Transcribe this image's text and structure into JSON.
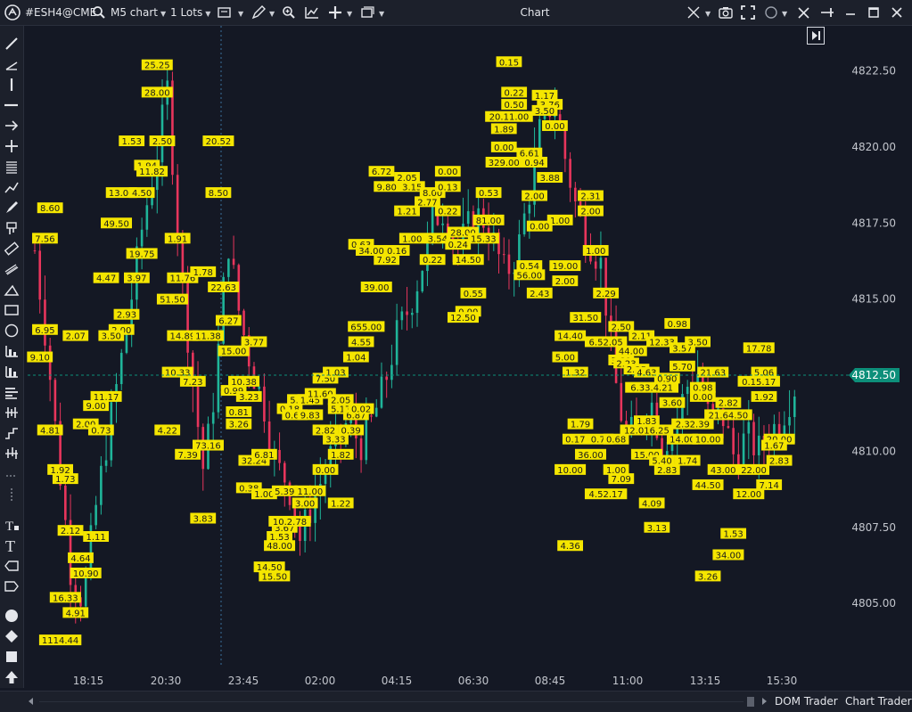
{
  "topbar": {
    "symbol": "#ESH4@CME",
    "timeframe": "M5 chart",
    "lots": "1 Lots",
    "title": "Chart"
  },
  "bottombar": {
    "dom_trader": "DOM Trader",
    "chart_trader": "Chart Trader"
  },
  "colors": {
    "background": "#141824",
    "up": "#1fb59a",
    "down": "#e8355c",
    "label_bg": "#f5e600",
    "current_price": "#0d8f7a"
  },
  "chart_data": {
    "type": "candlestick",
    "symbol": "#ESH4@CME",
    "timeframe": "M5",
    "y_ticks": [
      "4822.50",
      "4820.00",
      "4817.50",
      "4815.00",
      "4812.50",
      "4810.00",
      "4807.50",
      "4805.00"
    ],
    "ylim": [
      4803.0,
      4823.5
    ],
    "x_ticks": [
      "18:15",
      "20:30",
      "23:45",
      "02:00",
      "04:15",
      "06:30",
      "08:45",
      "11:00",
      "13:15",
      "15:30"
    ],
    "current_price": "4812.50",
    "closes": [
      4816.6,
      4813.5,
      4809.6,
      4806.0,
      4805.1,
      4808.0,
      4810.4,
      4812.6,
      4815.0,
      4817.6,
      4819.4,
      4821.9,
      4816.5,
      4812.6,
      4809.3,
      4812.3,
      4817.0,
      4814.4,
      4812.7,
      4811.5,
      4809.5,
      4809.0,
      4807.1,
      4808.3,
      4809.3,
      4810.3,
      4811.0,
      4810.2,
      4811.0,
      4812.2,
      4813.8,
      4814.7,
      4815.9,
      4817.6,
      4818.0,
      4816.6,
      4817.4,
      4817.8,
      4816.9,
      4815.8,
      4816.5,
      4818.5,
      4820.8,
      4821.5,
      4819.6,
      4817.8,
      4816.9,
      4816.1,
      4812.6,
      4810.4,
      4810.8,
      4811.8,
      4810.3,
      4810.7,
      4812.1,
      4812.6,
      4810.9,
      4811.2,
      4809.8,
      4810.5,
      4810.0,
      4810.6,
      4811.2,
      4812.1
    ],
    "labels": [
      {
        "text": "25.25",
        "x": 24,
        "y": 4822.7
      },
      {
        "text": "28.00",
        "x": 24,
        "y": 4821.8
      },
      {
        "text": "1.53",
        "x": 19,
        "y": 4820.2
      },
      {
        "text": "2.50",
        "x": 25,
        "y": 4820.2
      },
      {
        "text": "20.52",
        "x": 36,
        "y": 4820.2
      },
      {
        "text": "1.94",
        "x": 22,
        "y": 4819.4
      },
      {
        "text": "11.82",
        "x": 23,
        "y": 4819.2
      },
      {
        "text": "13.00",
        "x": 17,
        "y": 4818.5
      },
      {
        "text": "4.50",
        "x": 21,
        "y": 4818.5
      },
      {
        "text": "8.50",
        "x": 36,
        "y": 4818.5
      },
      {
        "text": "8.60",
        "x": 3,
        "y": 4818.0
      },
      {
        "text": "49.50",
        "x": 16,
        "y": 4817.5
      },
      {
        "text": "7.56",
        "x": 2,
        "y": 4817.0
      },
      {
        "text": "1.91",
        "x": 28,
        "y": 4817.0
      },
      {
        "text": "19.75",
        "x": 21,
        "y": 4816.5
      },
      {
        "text": "4.47",
        "x": 14,
        "y": 4815.7
      },
      {
        "text": "3.97",
        "x": 20,
        "y": 4815.7
      },
      {
        "text": "11.76",
        "x": 29,
        "y": 4815.7
      },
      {
        "text": "1.78",
        "x": 33,
        "y": 4815.9
      },
      {
        "text": "22.63",
        "x": 37,
        "y": 4815.4
      },
      {
        "text": "51.50",
        "x": 27,
        "y": 4815.0
      },
      {
        "text": "2.93",
        "x": 18,
        "y": 4814.5
      },
      {
        "text": "6.27",
        "x": 38,
        "y": 4814.3
      },
      {
        "text": "6.95",
        "x": 2,
        "y": 4814.0
      },
      {
        "text": "2.00",
        "x": 17,
        "y": 4814.0
      },
      {
        "text": "3.50",
        "x": 15,
        "y": 4813.8
      },
      {
        "text": "2.07",
        "x": 8,
        "y": 4813.8
      },
      {
        "text": "14.89",
        "x": 29,
        "y": 4813.8
      },
      {
        "text": "11.38",
        "x": 34,
        "y": 4813.8
      },
      {
        "text": "3.77",
        "x": 43,
        "y": 4813.6
      },
      {
        "text": "15.00",
        "x": 39,
        "y": 4813.3
      },
      {
        "text": "9.10",
        "x": 1,
        "y": 4813.1
      },
      {
        "text": "10.33",
        "x": 28,
        "y": 4812.6
      },
      {
        "text": "7.23",
        "x": 31,
        "y": 4812.3
      },
      {
        "text": "10.38",
        "x": 41,
        "y": 4812.3
      },
      {
        "text": "0.99",
        "x": 39,
        "y": 4812.0
      },
      {
        "text": "3.23",
        "x": 42,
        "y": 4811.8
      },
      {
        "text": "11.17",
        "x": 14,
        "y": 4811.8
      },
      {
        "text": "9.00",
        "x": 12,
        "y": 4811.5
      },
      {
        "text": "0.81",
        "x": 40,
        "y": 4811.3
      },
      {
        "text": "3.26",
        "x": 40,
        "y": 4810.9
      },
      {
        "text": "2.00",
        "x": 10,
        "y": 4810.9
      },
      {
        "text": "4.81",
        "x": 3,
        "y": 4810.7
      },
      {
        "text": "0.73",
        "x": 13,
        "y": 4810.7
      },
      {
        "text": "4.22",
        "x": 26,
        "y": 4810.7
      },
      {
        "text": "73.16",
        "x": 34,
        "y": 4810.2
      },
      {
        "text": "7.39",
        "x": 30,
        "y": 4809.9
      },
      {
        "text": "32.24",
        "x": 43,
        "y": 4809.7
      },
      {
        "text": "6.81",
        "x": 45,
        "y": 4809.9
      },
      {
        "text": "1.92",
        "x": 5,
        "y": 4809.4
      },
      {
        "text": "1.73",
        "x": 6,
        "y": 4809.1
      },
      {
        "text": "0.38",
        "x": 42,
        "y": 4808.8
      },
      {
        "text": "1.00",
        "x": 45,
        "y": 4808.6
      },
      {
        "text": "3.83",
        "x": 33,
        "y": 4807.8
      },
      {
        "text": "2.12",
        "x": 7,
        "y": 4807.4
      },
      {
        "text": "1.11",
        "x": 12,
        "y": 4807.2
      },
      {
        "text": "4.64",
        "x": 9,
        "y": 4806.5
      },
      {
        "text": "10.90",
        "x": 10,
        "y": 4806.0
      },
      {
        "text": "16.33",
        "x": 6,
        "y": 4805.2
      },
      {
        "text": "4.91",
        "x": 8,
        "y": 4804.7
      },
      {
        "text": "1114.44",
        "x": 5,
        "y": 4803.8
      },
      {
        "text": "14.50",
        "x": 46,
        "y": 4806.2
      },
      {
        "text": "15.50",
        "x": 47,
        "y": 4805.9
      },
      {
        "text": "48.00",
        "x": 48,
        "y": 4806.9
      },
      {
        "text": "1.53",
        "x": 48,
        "y": 4807.2
      },
      {
        "text": "3.67",
        "x": 49,
        "y": 4807.5
      },
      {
        "text": "10.2.78",
        "x": 50,
        "y": 4807.7
      },
      {
        "text": "5.39",
        "x": 49,
        "y": 4808.7
      },
      {
        "text": "3.00",
        "x": 53,
        "y": 4808.3
      },
      {
        "text": "11.00",
        "x": 54,
        "y": 4808.7
      },
      {
        "text": "0.00",
        "x": 57,
        "y": 4809.4
      },
      {
        "text": "0.18",
        "x": 50,
        "y": 4811.4
      },
      {
        "text": "0.62",
        "x": 51,
        "y": 4811.2
      },
      {
        "text": "9.83",
        "x": 54,
        "y": 4811.2
      },
      {
        "text": "5.38",
        "x": 52,
        "y": 4811.7
      },
      {
        "text": "1.45",
        "x": 54,
        "y": 4811.7
      },
      {
        "text": "11.60",
        "x": 56,
        "y": 4811.9
      },
      {
        "text": "7.50",
        "x": 57,
        "y": 4812.4
      },
      {
        "text": "1.03",
        "x": 59,
        "y": 4812.6
      },
      {
        "text": "2.82",
        "x": 57,
        "y": 4810.7
      },
      {
        "text": "3.33",
        "x": 59,
        "y": 4810.4
      },
      {
        "text": "1.82",
        "x": 60,
        "y": 4809.9
      },
      {
        "text": "1.22",
        "x": 60,
        "y": 4808.3
      },
      {
        "text": "2.05",
        "x": 60,
        "y": 4811.7
      },
      {
        "text": "5.17",
        "x": 60,
        "y": 4811.4
      },
      {
        "text": "0.39",
        "x": 62,
        "y": 4810.7
      },
      {
        "text": "6.87",
        "x": 63,
        "y": 4811.2
      },
      {
        "text": "0.02",
        "x": 64,
        "y": 4811.4
      },
      {
        "text": "1.04",
        "x": 63,
        "y": 4813.1
      },
      {
        "text": "4.55",
        "x": 64,
        "y": 4813.6
      },
      {
        "text": "655.00",
        "x": 65,
        "y": 4814.1
      },
      {
        "text": "39.00",
        "x": 67,
        "y": 4815.4
      },
      {
        "text": "0.63",
        "x": 64,
        "y": 4816.8
      },
      {
        "text": "34.00",
        "x": 66,
        "y": 4816.6
      },
      {
        "text": "7.92",
        "x": 69,
        "y": 4816.3
      },
      {
        "text": "0.16",
        "x": 71,
        "y": 4816.6
      },
      {
        "text": "1.00",
        "x": 74,
        "y": 4817.0
      },
      {
        "text": "1.21",
        "x": 73,
        "y": 4817.9
      },
      {
        "text": "0.22",
        "x": 78,
        "y": 4816.3
      },
      {
        "text": "6.72",
        "x": 68,
        "y": 4819.2
      },
      {
        "text": "9.80",
        "x": 69,
        "y": 4818.7
      },
      {
        "text": "2.05",
        "x": 73,
        "y": 4819.0
      },
      {
        "text": "3.15",
        "x": 74,
        "y": 4818.7
      },
      {
        "text": "2.77",
        "x": 77,
        "y": 4818.2
      },
      {
        "text": "8.00",
        "x": 78,
        "y": 4818.5
      },
      {
        "text": "0.00",
        "x": 81,
        "y": 4819.2
      },
      {
        "text": "0.13",
        "x": 81,
        "y": 4818.7
      },
      {
        "text": "0.22",
        "x": 81,
        "y": 4817.9
      },
      {
        "text": "3.54",
        "x": 79,
        "y": 4817.0
      },
      {
        "text": "28.00",
        "x": 84,
        "y": 4817.2
      },
      {
        "text": "0.24",
        "x": 83,
        "y": 4816.8
      },
      {
        "text": "14.50",
        "x": 85,
        "y": 4816.3
      },
      {
        "text": "15.33",
        "x": 88,
        "y": 4817.0
      },
      {
        "text": "0.55",
        "x": 86,
        "y": 4815.2
      },
      {
        "text": "0.00",
        "x": 85,
        "y": 4814.6
      },
      {
        "text": "12.50",
        "x": 84,
        "y": 4814.4
      },
      {
        "text": "81.00",
        "x": 89,
        "y": 4817.6
      },
      {
        "text": "0.53",
        "x": 89,
        "y": 4818.5
      },
      {
        "text": "0.15",
        "x": 93,
        "y": 4822.8
      },
      {
        "text": "0.22",
        "x": 94,
        "y": 4821.8
      },
      {
        "text": "0.50",
        "x": 94,
        "y": 4821.4
      },
      {
        "text": "20.11.00",
        "x": 93,
        "y": 4821.0
      },
      {
        "text": "1.89",
        "x": 92,
        "y": 4820.6
      },
      {
        "text": "0.00",
        "x": 92,
        "y": 4820.0
      },
      {
        "text": "329.00",
        "x": 92,
        "y": 4819.5
      },
      {
        "text": "1.17",
        "x": 100,
        "y": 4821.7
      },
      {
        "text": "3.76",
        "x": 101,
        "y": 4821.4
      },
      {
        "text": "3.50",
        "x": 100,
        "y": 4821.2
      },
      {
        "text": "0.00",
        "x": 102,
        "y": 4820.7
      },
      {
        "text": "6.61",
        "x": 97,
        "y": 4819.8
      },
      {
        "text": "0.94",
        "x": 98,
        "y": 4819.5
      },
      {
        "text": "3.88",
        "x": 101,
        "y": 4819.0
      },
      {
        "text": "2.00",
        "x": 98,
        "y": 4818.4
      },
      {
        "text": "1.00",
        "x": 103,
        "y": 4817.6
      },
      {
        "text": "0.00",
        "x": 99,
        "y": 4817.4
      },
      {
        "text": "2.31",
        "x": 109,
        "y": 4818.4
      },
      {
        "text": "2.00",
        "x": 109,
        "y": 4817.9
      },
      {
        "text": "1.00",
        "x": 110,
        "y": 4816.6
      },
      {
        "text": "0.54",
        "x": 97,
        "y": 4816.1
      },
      {
        "text": "56.00",
        "x": 97,
        "y": 4815.8
      },
      {
        "text": "2.43",
        "x": 99,
        "y": 4815.2
      },
      {
        "text": "19.00",
        "x": 104,
        "y": 4816.1
      },
      {
        "text": "2.00",
        "x": 104,
        "y": 4815.6
      },
      {
        "text": "2.29",
        "x": 112,
        "y": 4815.2
      },
      {
        "text": "31.50",
        "x": 108,
        "y": 4814.4
      },
      {
        "text": "14.40",
        "x": 105,
        "y": 4813.8
      },
      {
        "text": "2.50",
        "x": 115,
        "y": 4814.1
      },
      {
        "text": "6.52.05",
        "x": 112,
        "y": 4813.6
      },
      {
        "text": "44.00",
        "x": 117,
        "y": 4813.3
      },
      {
        "text": "2.11",
        "x": 119,
        "y": 4813.8
      },
      {
        "text": "12.33",
        "x": 123,
        "y": 4813.6
      },
      {
        "text": "0.98",
        "x": 126,
        "y": 4814.2
      },
      {
        "text": "3.57",
        "x": 127,
        "y": 4813.4
      },
      {
        "text": "3.50",
        "x": 130,
        "y": 4813.6
      },
      {
        "text": "5.00",
        "x": 104,
        "y": 4813.1
      },
      {
        "text": "3.80",
        "x": 115,
        "y": 4813.0
      },
      {
        "text": "2.23",
        "x": 116,
        "y": 4812.9
      },
      {
        "text": "2.25",
        "x": 118,
        "y": 4812.7
      },
      {
        "text": "1.32",
        "x": 106,
        "y": 4812.6
      },
      {
        "text": "4.63",
        "x": 120,
        "y": 4812.6
      },
      {
        "text": "5.70",
        "x": 127,
        "y": 4812.8
      },
      {
        "text": "21.63",
        "x": 133,
        "y": 4812.6
      },
      {
        "text": "17.78",
        "x": 142,
        "y": 4813.4
      },
      {
        "text": "5.06",
        "x": 143,
        "y": 4812.6
      },
      {
        "text": "0.15.17",
        "x": 142,
        "y": 4812.3
      },
      {
        "text": "6.33.4.21",
        "x": 121,
        "y": 4812.1
      },
      {
        "text": "0.90",
        "x": 124,
        "y": 4812.4
      },
      {
        "text": "0.98",
        "x": 131,
        "y": 4812.1
      },
      {
        "text": "0.00",
        "x": 131,
        "y": 4811.8
      },
      {
        "text": "1.92",
        "x": 143,
        "y": 4811.8
      },
      {
        "text": "3.60",
        "x": 125,
        "y": 4811.6
      },
      {
        "text": "2.82",
        "x": 136,
        "y": 4811.6
      },
      {
        "text": "21.64.50",
        "x": 136,
        "y": 4811.2
      },
      {
        "text": "1.83",
        "x": 120,
        "y": 4811.0
      },
      {
        "text": "2.32.39",
        "x": 129,
        "y": 4810.9
      },
      {
        "text": "1.79",
        "x": 107,
        "y": 4810.9
      },
      {
        "text": "12.016.25",
        "x": 120,
        "y": 4810.7
      },
      {
        "text": "0.17",
        "x": 106,
        "y": 4810.4
      },
      {
        "text": "0.70",
        "x": 111,
        "y": 4810.4
      },
      {
        "text": "0.68",
        "x": 114,
        "y": 4810.4
      },
      {
        "text": "14.00",
        "x": 127,
        "y": 4810.4
      },
      {
        "text": "10.00",
        "x": 132,
        "y": 4810.4
      },
      {
        "text": "20.00",
        "x": 146,
        "y": 4810.4
      },
      {
        "text": "1.67",
        "x": 145,
        "y": 4810.2
      },
      {
        "text": "36.00",
        "x": 109,
        "y": 4809.9
      },
      {
        "text": "15.00",
        "x": 120,
        "y": 4809.9
      },
      {
        "text": "5.40",
        "x": 123,
        "y": 4809.7
      },
      {
        "text": "1.74",
        "x": 128,
        "y": 4809.7
      },
      {
        "text": "2.83",
        "x": 146,
        "y": 4809.7
      },
      {
        "text": "10.00",
        "x": 105,
        "y": 4809.4
      },
      {
        "text": "1.00",
        "x": 114,
        "y": 4809.4
      },
      {
        "text": "2.83",
        "x": 124,
        "y": 4809.4
      },
      {
        "text": "43.00",
        "x": 135,
        "y": 4809.4
      },
      {
        "text": "22.00",
        "x": 141,
        "y": 4809.4
      },
      {
        "text": "7.09",
        "x": 115,
        "y": 4809.1
      },
      {
        "text": "44.50",
        "x": 132,
        "y": 4808.9
      },
      {
        "text": "7.14",
        "x": 144,
        "y": 4808.9
      },
      {
        "text": "4.52.17",
        "x": 112,
        "y": 4808.6
      },
      {
        "text": "12.00",
        "x": 140,
        "y": 4808.6
      },
      {
        "text": "4.09",
        "x": 121,
        "y": 4808.3
      },
      {
        "text": "3.13",
        "x": 122,
        "y": 4807.5
      },
      {
        "text": "1.53",
        "x": 137,
        "y": 4807.3
      },
      {
        "text": "4.36",
        "x": 105,
        "y": 4806.9
      },
      {
        "text": "34.00",
        "x": 136,
        "y": 4806.6
      },
      {
        "text": "3.26",
        "x": 132,
        "y": 4805.9
      }
    ]
  }
}
